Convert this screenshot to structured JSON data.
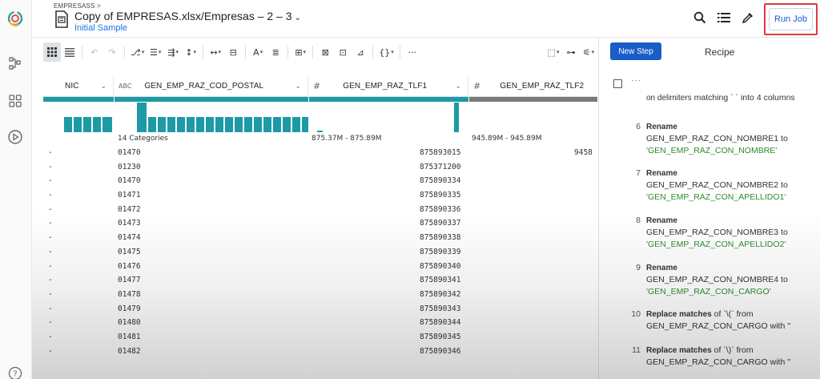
{
  "header": {
    "breadcrumb": "EMPRESASS >",
    "title": "Copy of EMPRESAS.xlsx/Empresas – 2 – 3",
    "title_caret": "⌄",
    "sample": "Initial Sample",
    "run_job": "Run Job"
  },
  "toolbar": {
    "more": "···"
  },
  "grid": {
    "columns": [
      {
        "type": "",
        "name": "NIC",
        "stats": ""
      },
      {
        "type": "ABC",
        "name": "GEN_EMP_RAZ_COD_POSTAL",
        "stats": "14 Categories"
      },
      {
        "type": "#",
        "name": "GEN_EMP_RAZ_TLF1",
        "stats": "875.37M - 875.89M"
      },
      {
        "type": "#",
        "name": "GEN_EMP_RAZ_TLF2",
        "stats": "945.89M - 945.89M"
      }
    ],
    "rows": [
      {
        "a": "-",
        "postal": "01470",
        "tlf1": "875893015",
        "tlf2": "9458"
      },
      {
        "a": "-",
        "postal": "01230",
        "tlf1": "875371200",
        "tlf2": ""
      },
      {
        "a": "-",
        "postal": "01470",
        "tlf1": "875890334",
        "tlf2": ""
      },
      {
        "a": "-",
        "postal": "01471",
        "tlf1": "875890335",
        "tlf2": ""
      },
      {
        "a": "-",
        "postal": "01472",
        "tlf1": "875890336",
        "tlf2": ""
      },
      {
        "a": "-",
        "postal": "01473",
        "tlf1": "875890337",
        "tlf2": ""
      },
      {
        "a": "-",
        "postal": "01474",
        "tlf1": "875890338",
        "tlf2": ""
      },
      {
        "a": "-",
        "postal": "01475",
        "tlf1": "875890339",
        "tlf2": ""
      },
      {
        "a": "-",
        "postal": "01476",
        "tlf1": "875890340",
        "tlf2": ""
      },
      {
        "a": "-",
        "postal": "01477",
        "tlf1": "875890341",
        "tlf2": ""
      },
      {
        "a": "-",
        "postal": "01478",
        "tlf1": "875890342",
        "tlf2": ""
      },
      {
        "a": "-",
        "postal": "01479",
        "tlf1": "875890343",
        "tlf2": ""
      },
      {
        "a": "-",
        "postal": "01480",
        "tlf1": "875890344",
        "tlf2": ""
      },
      {
        "a": "-",
        "postal": "01481",
        "tlf1": "875890345",
        "tlf2": ""
      },
      {
        "a": "-",
        "postal": "01482",
        "tlf1": "875890346",
        "tlf2": ""
      }
    ]
  },
  "recipe": {
    "new_step": "New Step",
    "title": "Recipe",
    "more": "···",
    "top_step": {
      "kw": "on delimiters",
      "text": " matching ` ` into 4 columns"
    },
    "steps": [
      {
        "num": "6",
        "kw": "Rename",
        "text": "GEN_EMP_RAZ_CON_NOMBRE1 to ",
        "val": "'GEN_EMP_RAZ_CON_NOMBRE'"
      },
      {
        "num": "7",
        "kw": "Rename",
        "text": "GEN_EMP_RAZ_CON_NOMBRE2 to ",
        "val": "'GEN_EMP_RAZ_CON_APELLIDO1'"
      },
      {
        "num": "8",
        "kw": "Rename",
        "text": "GEN_EMP_RAZ_CON_NOMBRE3 to ",
        "val": "'GEN_EMP_RAZ_CON_APELLIDO2'"
      },
      {
        "num": "9",
        "kw": "Rename",
        "text": "GEN_EMP_RAZ_CON_NOMBRE4 to ",
        "val": "'GEN_EMP_RAZ_CON_CARGO'"
      },
      {
        "num": "10",
        "kw": "Replace matches",
        "text": " of `\\(` from GEN_EMP_RAZ_CON_CARGO with ''",
        "val": ""
      },
      {
        "num": "11",
        "kw": "Replace matches",
        "text": " of `\\)` from GEN_EMP_RAZ_CON_CARGO with ''",
        "val": ""
      }
    ]
  },
  "colors": {
    "accent": "#1a5dc9",
    "histogram": "#1d9aa6",
    "highlight_border": "#e0393e",
    "recipe_value": "#2e8b2e"
  }
}
